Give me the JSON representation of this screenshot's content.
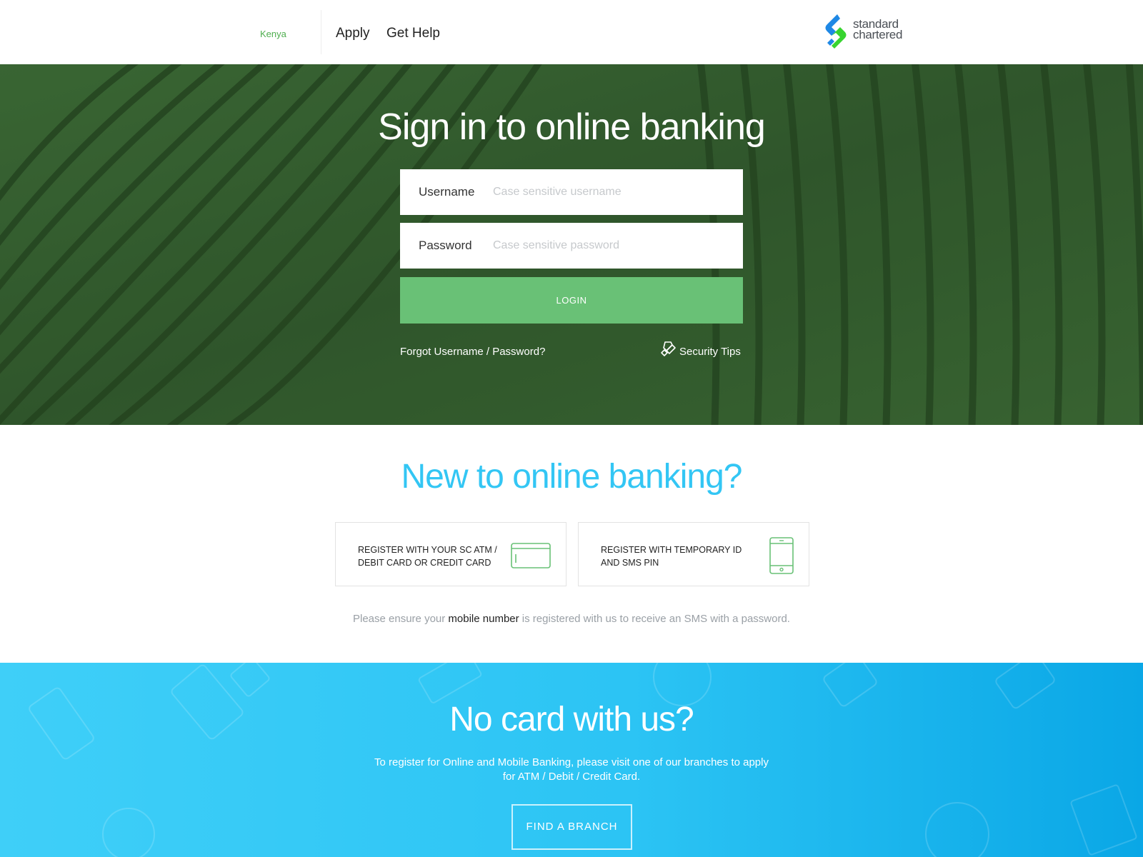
{
  "header": {
    "country": "Kenya",
    "nav": {
      "apply": "Apply",
      "get_help": "Get Help"
    },
    "logo": {
      "line1": "standard",
      "line2": "chartered"
    }
  },
  "login": {
    "title": "Sign in to online banking",
    "username": {
      "label": "Username",
      "placeholder": "Case sensitive username"
    },
    "password": {
      "label": "Password",
      "placeholder": "Case sensitive password"
    },
    "login_button": "LOGIN",
    "forgot": "Forgot Username / Password?",
    "security_tips": "Security Tips"
  },
  "register": {
    "title": "New to online banking?",
    "card_option": "REGISTER WITH YOUR SC ATM / DEBIT CARD OR CREDIT CARD",
    "sms_option": "REGISTER WITH TEMPORARY ID AND SMS PIN",
    "note_before": "Please ensure your ",
    "note_emphasis": "mobile number",
    "note_after": " is registered with us to receive an SMS with a password."
  },
  "no_card": {
    "title": "No card with us?",
    "text": "To register for Online and Mobile Banking, please visit one of our branches to apply for ATM / Debit / Credit Card.",
    "button": "FIND A BRANCH"
  },
  "colors": {
    "brand_green": "#69c176",
    "brand_blue": "#33c6f4",
    "hero_green": "#3a6233"
  },
  "icons": [
    "standard-chartered-logo",
    "security-shield-icon",
    "credit-card-icon",
    "mobile-phone-icon"
  ]
}
